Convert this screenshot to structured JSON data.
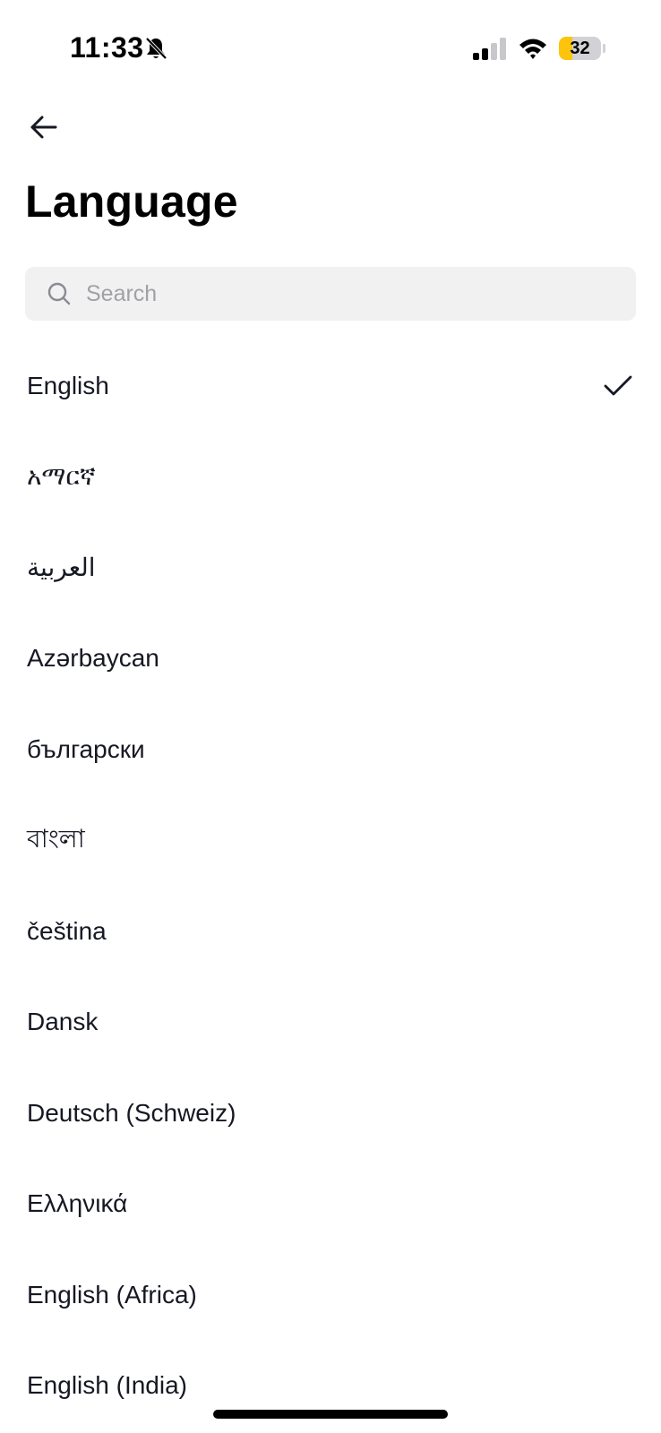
{
  "status_bar": {
    "time": "11:33",
    "battery_level": "32",
    "battery_fraction": 0.32,
    "battery_color": "#fcc40c",
    "icons": [
      "bell-slash-icon",
      "signal-icon",
      "wifi-icon",
      "battery-icon"
    ]
  },
  "header": {
    "back_icon": "arrow-left-icon",
    "title": "Language"
  },
  "search": {
    "placeholder": "Search",
    "value": ""
  },
  "languages": [
    {
      "label": "English",
      "selected": true
    },
    {
      "label": "አማርኛ",
      "selected": false
    },
    {
      "label": "العربية",
      "selected": false
    },
    {
      "label": "Azərbaycan",
      "selected": false
    },
    {
      "label": "български",
      "selected": false
    },
    {
      "label": "বাংলা",
      "selected": false
    },
    {
      "label": "čeština",
      "selected": false
    },
    {
      "label": "Dansk",
      "selected": false
    },
    {
      "label": "Deutsch (Schweiz)",
      "selected": false
    },
    {
      "label": "Ελληνικά",
      "selected": false
    },
    {
      "label": "English (Africa)",
      "selected": false
    },
    {
      "label": "English (India)",
      "selected": false
    }
  ]
}
